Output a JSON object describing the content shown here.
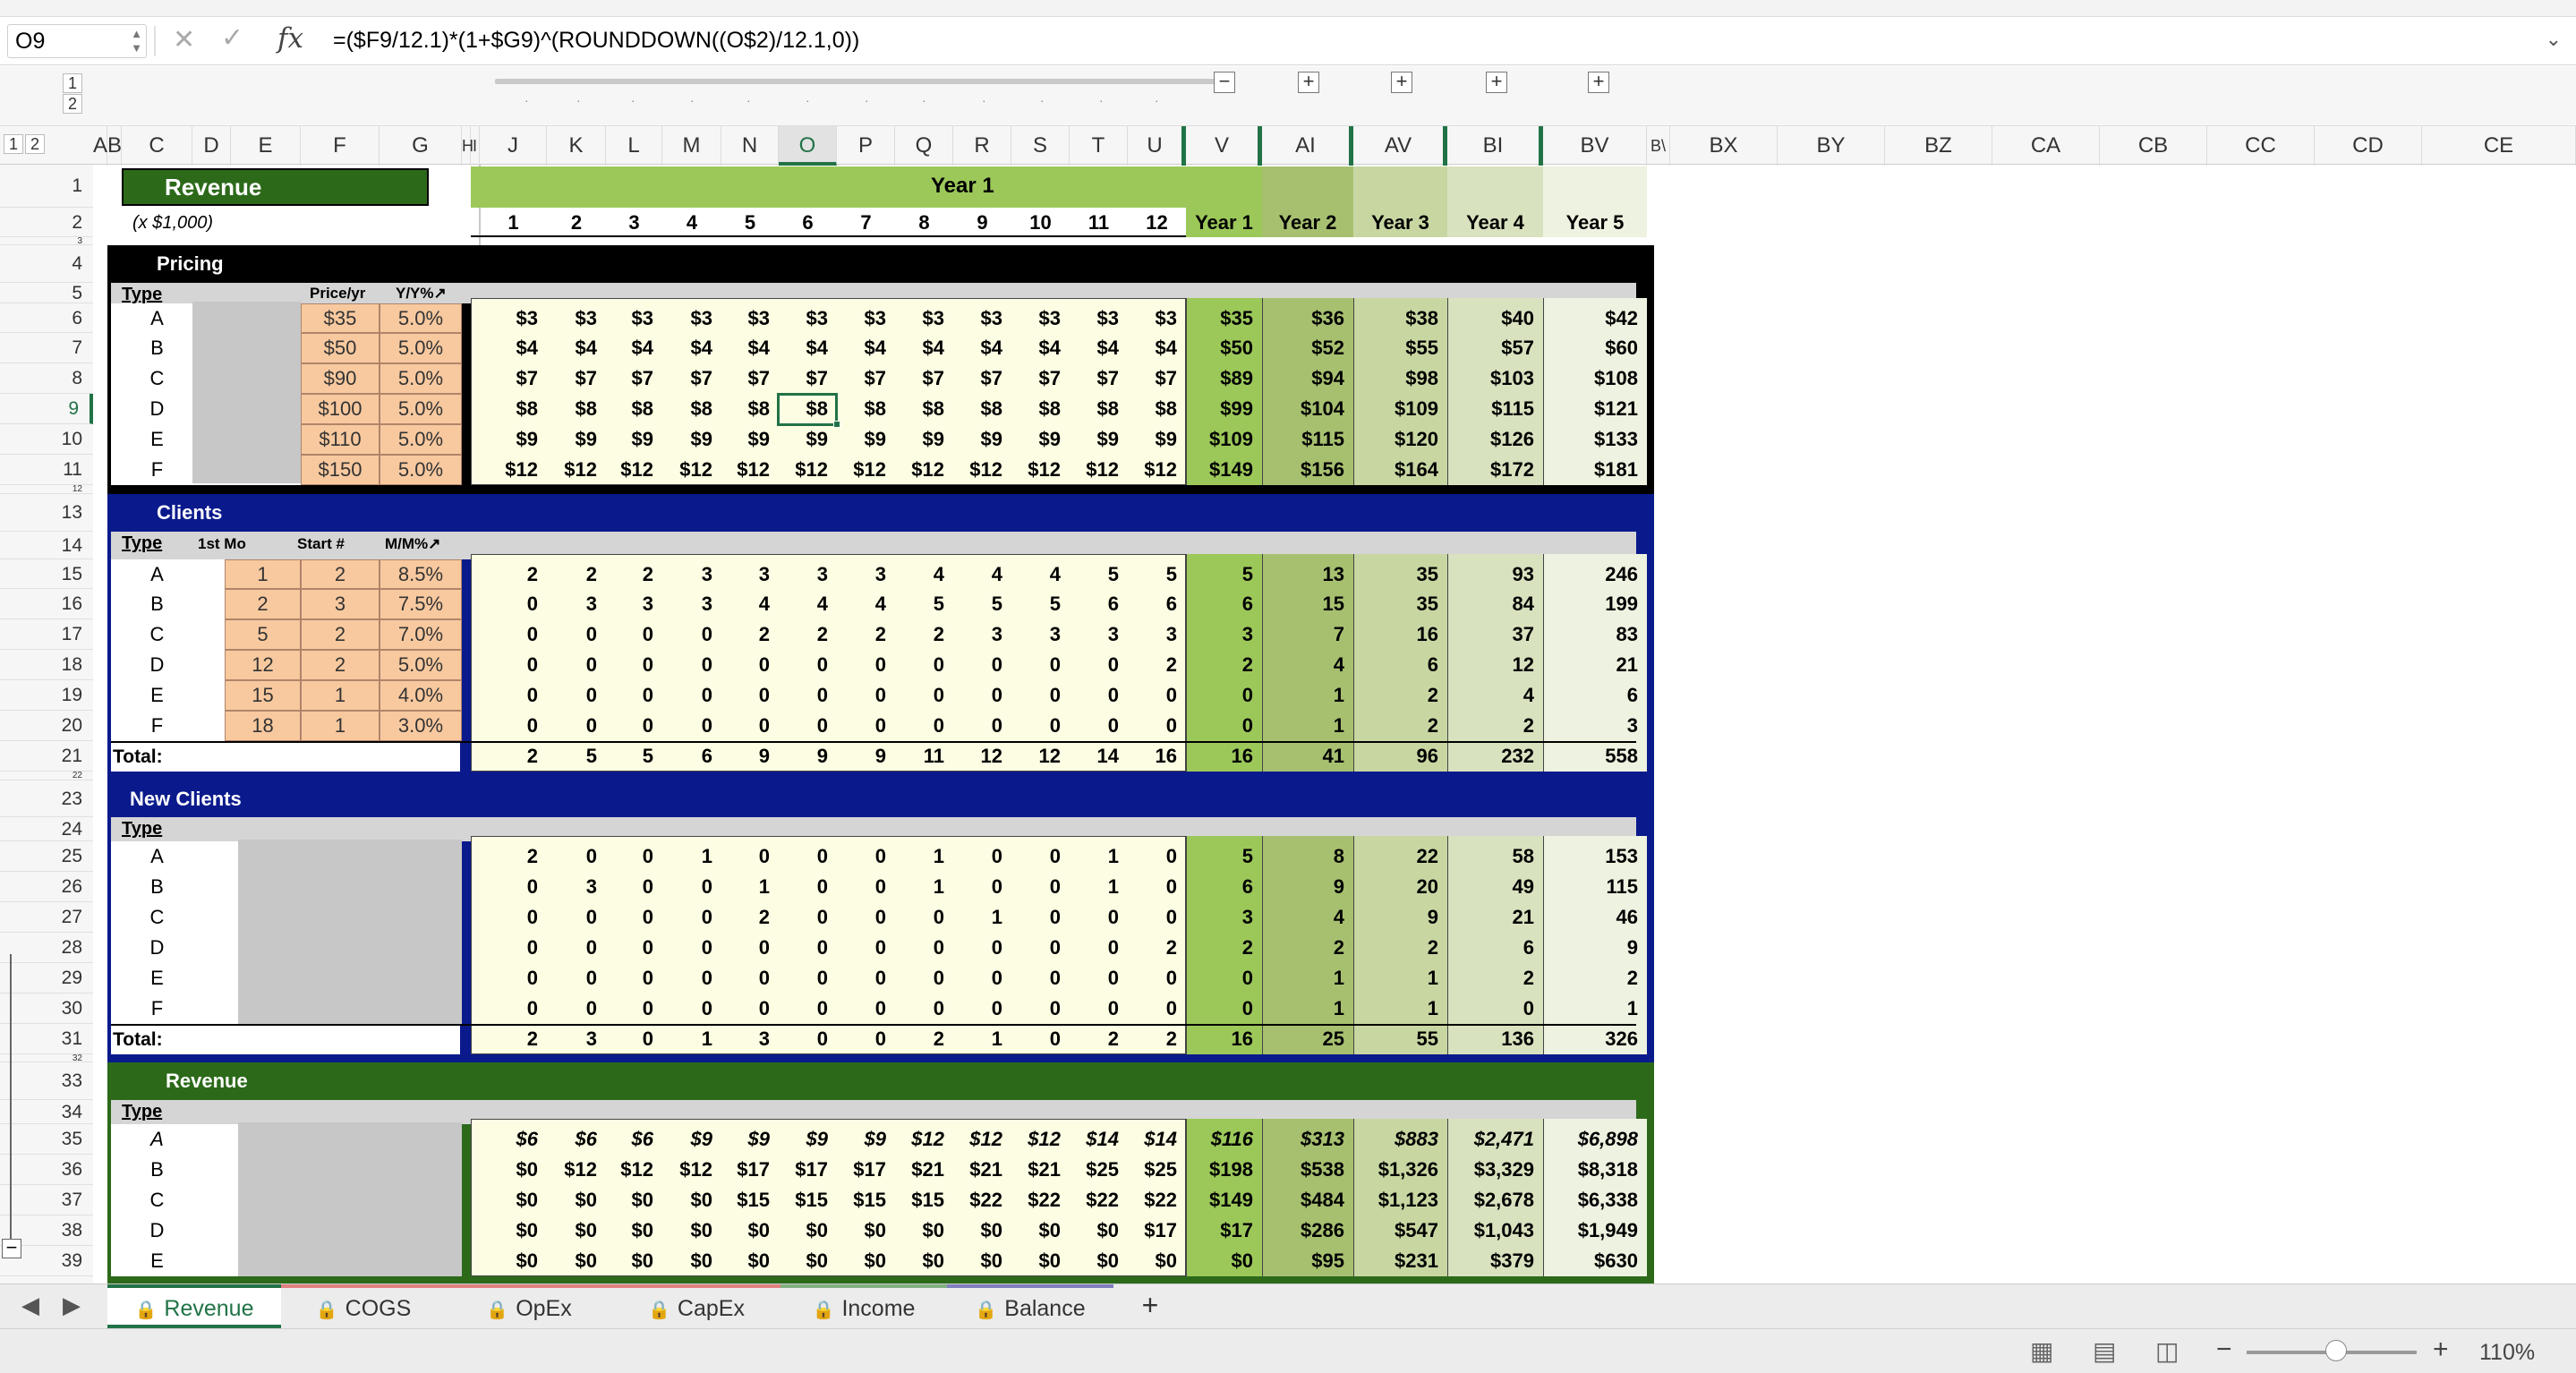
{
  "formula_bar": {
    "name_box": "O9",
    "formula": "=($F9/12.1)*(1+$G9)^(ROUNDDOWN((O$2)/12.1,0))",
    "cancel_icon": "close-icon",
    "enter_icon": "check-icon",
    "fx": "fx",
    "expand_icon": "chevron-down-icon"
  },
  "outline": {
    "levels": [
      "1",
      "2"
    ],
    "row_levels": [
      "1",
      "2"
    ],
    "expand_buttons": [
      "+",
      "+",
      "+",
      "+",
      "+"
    ],
    "collapse_button": "−"
  },
  "columns": [
    "A",
    "B",
    "C",
    "D",
    "E",
    "F",
    "G",
    "H",
    "I",
    "J",
    "K",
    "L",
    "M",
    "N",
    "O",
    "P",
    "Q",
    "R",
    "S",
    "T",
    "U",
    "V",
    "AI",
    "AV",
    "BI",
    "BV",
    "BW",
    "BX",
    "BY",
    "BZ",
    "CA",
    "CB",
    "CC",
    "CD",
    "CE"
  ],
  "col_labels": {
    "a": "A",
    "b": "B",
    "bw": "B\\"
  },
  "rows": [
    "1",
    "2",
    "3",
    "4",
    "5",
    "6",
    "7",
    "8",
    "9",
    "10",
    "11",
    "12",
    "13",
    "14",
    "15",
    "16",
    "17",
    "18",
    "19",
    "20",
    "21",
    "22",
    "23",
    "24",
    "25",
    "26",
    "27",
    "28",
    "29",
    "30",
    "31",
    "32",
    "33",
    "34",
    "35",
    "36",
    "37",
    "38",
    "39"
  ],
  "header": {
    "revenue_label": "Revenue",
    "units": "(x $1,000)",
    "year1_banner": "Year 1",
    "months": [
      "1",
      "2",
      "3",
      "4",
      "5",
      "6",
      "7",
      "8",
      "9",
      "10",
      "11",
      "12"
    ],
    "years": [
      "Year 1",
      "Year 2",
      "Year 3",
      "Year 4",
      "Year 5"
    ]
  },
  "types": [
    "A",
    "B",
    "C",
    "D",
    "E",
    "F"
  ],
  "pricing": {
    "title": "Pricing",
    "type_label": "Type",
    "price_label": "Price/yr",
    "growth_label": "Y/Y%↗",
    "prices": [
      "$35",
      "$50",
      "$90",
      "$100",
      "$110",
      "$150"
    ],
    "growth": [
      "5.0%",
      "5.0%",
      "5.0%",
      "5.0%",
      "5.0%",
      "5.0%"
    ],
    "monthly": [
      [
        "$3",
        "$3",
        "$3",
        "$3",
        "$3",
        "$3",
        "$3",
        "$3",
        "$3",
        "$3",
        "$3",
        "$3"
      ],
      [
        "$4",
        "$4",
        "$4",
        "$4",
        "$4",
        "$4",
        "$4",
        "$4",
        "$4",
        "$4",
        "$4",
        "$4"
      ],
      [
        "$7",
        "$7",
        "$7",
        "$7",
        "$7",
        "$7",
        "$7",
        "$7",
        "$7",
        "$7",
        "$7",
        "$7"
      ],
      [
        "$8",
        "$8",
        "$8",
        "$8",
        "$8",
        "$8",
        "$8",
        "$8",
        "$8",
        "$8",
        "$8",
        "$8"
      ],
      [
        "$9",
        "$9",
        "$9",
        "$9",
        "$9",
        "$9",
        "$9",
        "$9",
        "$9",
        "$9",
        "$9",
        "$9"
      ],
      [
        "$12",
        "$12",
        "$12",
        "$12",
        "$12",
        "$12",
        "$12",
        "$12",
        "$12",
        "$12",
        "$12",
        "$12"
      ]
    ],
    "yearly": [
      [
        "$35",
        "$36",
        "$38",
        "$40",
        "$42"
      ],
      [
        "$50",
        "$52",
        "$55",
        "$57",
        "$60"
      ],
      [
        "$89",
        "$94",
        "$98",
        "$103",
        "$108"
      ],
      [
        "$99",
        "$104",
        "$109",
        "$115",
        "$121"
      ],
      [
        "$109",
        "$115",
        "$120",
        "$126",
        "$133"
      ],
      [
        "$149",
        "$156",
        "$164",
        "$172",
        "$181"
      ]
    ]
  },
  "clients": {
    "title": "Clients",
    "type_label": "Type",
    "first_mo_label": "1st Mo",
    "start_label": "Start #",
    "growth_label": "M/M%↗",
    "first_mo": [
      "1",
      "2",
      "5",
      "12",
      "15",
      "18"
    ],
    "start": [
      "2",
      "3",
      "2",
      "2",
      "1",
      "1"
    ],
    "growth": [
      "8.5%",
      "7.5%",
      "7.0%",
      "5.0%",
      "4.0%",
      "3.0%"
    ],
    "monthly": [
      [
        "2",
        "2",
        "2",
        "3",
        "3",
        "3",
        "3",
        "4",
        "4",
        "4",
        "5",
        "5"
      ],
      [
        "0",
        "3",
        "3",
        "3",
        "4",
        "4",
        "4",
        "5",
        "5",
        "5",
        "6",
        "6"
      ],
      [
        "0",
        "0",
        "0",
        "0",
        "2",
        "2",
        "2",
        "2",
        "3",
        "3",
        "3",
        "3"
      ],
      [
        "0",
        "0",
        "0",
        "0",
        "0",
        "0",
        "0",
        "0",
        "0",
        "0",
        "0",
        "2"
      ],
      [
        "0",
        "0",
        "0",
        "0",
        "0",
        "0",
        "0",
        "0",
        "0",
        "0",
        "0",
        "0"
      ],
      [
        "0",
        "0",
        "0",
        "0",
        "0",
        "0",
        "0",
        "0",
        "0",
        "0",
        "0",
        "0"
      ]
    ],
    "yearly": [
      [
        "5",
        "13",
        "35",
        "93",
        "246"
      ],
      [
        "6",
        "15",
        "35",
        "84",
        "199"
      ],
      [
        "3",
        "7",
        "16",
        "37",
        "83"
      ],
      [
        "2",
        "4",
        "6",
        "12",
        "21"
      ],
      [
        "0",
        "1",
        "2",
        "4",
        "6"
      ],
      [
        "0",
        "1",
        "2",
        "2",
        "3"
      ]
    ],
    "total_label": "Total:",
    "total_monthly": [
      "2",
      "5",
      "5",
      "6",
      "9",
      "9",
      "9",
      "11",
      "12",
      "12",
      "14",
      "16"
    ],
    "total_yearly": [
      "16",
      "41",
      "96",
      "232",
      "558"
    ]
  },
  "new_clients": {
    "title": "New Clients",
    "type_label": "Type",
    "monthly": [
      [
        "2",
        "0",
        "0",
        "1",
        "0",
        "0",
        "0",
        "1",
        "0",
        "0",
        "1",
        "0"
      ],
      [
        "0",
        "3",
        "0",
        "0",
        "1",
        "0",
        "0",
        "1",
        "0",
        "0",
        "1",
        "0"
      ],
      [
        "0",
        "0",
        "0",
        "0",
        "2",
        "0",
        "0",
        "0",
        "1",
        "0",
        "0",
        "0"
      ],
      [
        "0",
        "0",
        "0",
        "0",
        "0",
        "0",
        "0",
        "0",
        "0",
        "0",
        "0",
        "2"
      ],
      [
        "0",
        "0",
        "0",
        "0",
        "0",
        "0",
        "0",
        "0",
        "0",
        "0",
        "0",
        "0"
      ],
      [
        "0",
        "0",
        "0",
        "0",
        "0",
        "0",
        "0",
        "0",
        "0",
        "0",
        "0",
        "0"
      ]
    ],
    "yearly": [
      [
        "5",
        "8",
        "22",
        "58",
        "153"
      ],
      [
        "6",
        "9",
        "20",
        "49",
        "115"
      ],
      [
        "3",
        "4",
        "9",
        "21",
        "46"
      ],
      [
        "2",
        "2",
        "2",
        "6",
        "9"
      ],
      [
        "0",
        "1",
        "1",
        "2",
        "2"
      ],
      [
        "0",
        "1",
        "1",
        "0",
        "1"
      ]
    ],
    "total_label": "Total:",
    "total_monthly": [
      "2",
      "3",
      "0",
      "1",
      "3",
      "0",
      "0",
      "2",
      "1",
      "0",
      "2",
      "2"
    ],
    "total_yearly": [
      "16",
      "25",
      "55",
      "136",
      "326"
    ]
  },
  "revenue": {
    "title": "Revenue",
    "type_label": "Type",
    "types": [
      "A",
      "B",
      "C",
      "D",
      "E"
    ],
    "monthly": [
      [
        "$6",
        "$6",
        "$6",
        "$9",
        "$9",
        "$9",
        "$9",
        "$12",
        "$12",
        "$12",
        "$14",
        "$14"
      ],
      [
        "$0",
        "$12",
        "$12",
        "$12",
        "$17",
        "$17",
        "$17",
        "$21",
        "$21",
        "$21",
        "$25",
        "$25"
      ],
      [
        "$0",
        "$0",
        "$0",
        "$0",
        "$15",
        "$15",
        "$15",
        "$15",
        "$22",
        "$22",
        "$22",
        "$22"
      ],
      [
        "$0",
        "$0",
        "$0",
        "$0",
        "$0",
        "$0",
        "$0",
        "$0",
        "$0",
        "$0",
        "$0",
        "$17"
      ],
      [
        "$0",
        "$0",
        "$0",
        "$0",
        "$0",
        "$0",
        "$0",
        "$0",
        "$0",
        "$0",
        "$0",
        "$0"
      ]
    ],
    "yearly": [
      [
        "$116",
        "$313",
        "$883",
        "$2,471",
        "$6,898"
      ],
      [
        "$198",
        "$538",
        "$1,326",
        "$3,329",
        "$8,318"
      ],
      [
        "$149",
        "$484",
        "$1,123",
        "$2,678",
        "$6,338"
      ],
      [
        "$17",
        "$286",
        "$547",
        "$1,043",
        "$1,949"
      ],
      [
        "$0",
        "$95",
        "$231",
        "$379",
        "$630"
      ]
    ]
  },
  "tabs": [
    "Revenue",
    "COGS",
    "OpEx",
    "CapEx",
    "Income",
    "Balance"
  ],
  "tab_colors": [
    "#217346",
    "#e08080",
    "#e08080",
    "#e08080",
    "#80b080",
    "#8080c0"
  ],
  "add_tab": "+",
  "nav": {
    "prev": "◀",
    "next": "▶"
  },
  "status": {
    "zoom": "110%",
    "zoom_minus": "−",
    "zoom_plus": "+"
  },
  "colors": {
    "pricing": "#000000",
    "clients": "#0a1a8c",
    "new_clients": "#0a1a8c",
    "revenue": "#2c6a1a",
    "year1": "#9cc85a",
    "year2": "#a7c070",
    "year3": "#c8d7a2",
    "year4": "#d8e2bf",
    "year5": "#eef2e0",
    "year_banner": "#9cc85a",
    "monthly": "#fdfde3",
    "orange": "#f8c99f"
  }
}
